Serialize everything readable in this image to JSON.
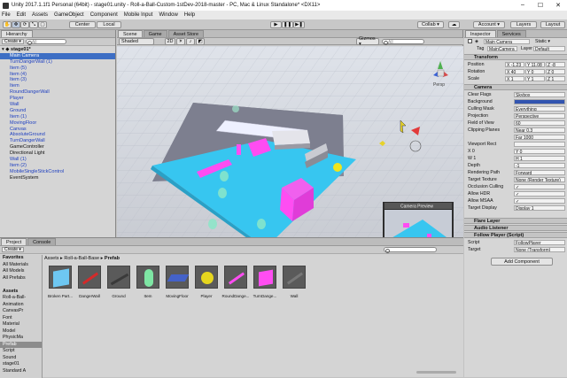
{
  "window": {
    "title": "Unity 2017.1.1f1 Personal (64bit) - stage01.unity - Roll-a-Ball-Custom-1stDev-2018-master - PC, Mac & Linux Standalone* <DX11>"
  },
  "menu": [
    "File",
    "Edit",
    "Assets",
    "GameObject",
    "Component",
    "Mobile Input",
    "Window",
    "Help"
  ],
  "toolbar": {
    "center": "Center",
    "local": "Local",
    "collab": "Collab ▾",
    "account": "Account ▾",
    "layers": "Layers",
    "layout": "Layout"
  },
  "hierarchy": {
    "tab": "Hierarchy",
    "create": "Create ▾",
    "search_placeholder": "All",
    "scene": "stage01*",
    "items": [
      {
        "label": "Main Camera",
        "sel": true
      },
      {
        "label": "TurnDangerWall (1)",
        "blue": true
      },
      {
        "label": "Item (5)",
        "blue": true
      },
      {
        "label": "Item (4)",
        "blue": true
      },
      {
        "label": "Item (3)",
        "blue": true
      },
      {
        "label": "Item",
        "blue": true
      },
      {
        "label": "RoundDangerWall",
        "blue": true
      },
      {
        "label": "Player",
        "blue": true
      },
      {
        "label": "Wall",
        "blue": true
      },
      {
        "label": "Ground",
        "blue": true
      },
      {
        "label": "Item (1)",
        "blue": true
      },
      {
        "label": "MovingFloor",
        "blue": true
      },
      {
        "label": "Canvas",
        "blue": true
      },
      {
        "label": "AbsoluteGround",
        "blue": true
      },
      {
        "label": "TurnDangerWall",
        "blue": true
      },
      {
        "label": "GameController"
      },
      {
        "label": "Directional Light"
      },
      {
        "label": "Wall (1)",
        "blue": true
      },
      {
        "label": "Item (2)",
        "blue": true
      },
      {
        "label": "MobileSingleStickControl",
        "blue": true
      },
      {
        "label": "EventSystem"
      }
    ]
  },
  "scene": {
    "tabs": [
      "Scene",
      "Game",
      "Asset Store"
    ],
    "shading": "Shaded",
    "mode2d": "2D",
    "gizmos": "Gizmos ▾",
    "search_placeholder": "All",
    "persp": "Persp",
    "camera_preview": "Camera Preview"
  },
  "inspector": {
    "tabs": [
      "Inspector",
      "Services"
    ],
    "object_name": "Main Camera",
    "static": "Static ▾",
    "tag_label": "Tag",
    "tag": "MainCamera",
    "layer_label": "Layer",
    "layer": "Default",
    "transform": {
      "title": "Transform",
      "position": {
        "label": "Position",
        "x": "X -1.23",
        "y": "Y 11.08",
        "z": "Z -8"
      },
      "rotation": {
        "label": "Rotation",
        "x": "X 40",
        "y": "Y 0",
        "z": "Z 0"
      },
      "scale": {
        "label": "Scale",
        "x": "X 1",
        "y": "Y 1",
        "z": "Z 1"
      }
    },
    "camera": {
      "title": "Camera",
      "rows": [
        {
          "label": "Clear Flags",
          "value": "Skybox"
        },
        {
          "label": "Background",
          "value": ""
        },
        {
          "label": "Culling Mask",
          "value": "Everything"
        },
        {
          "label": "Projection",
          "value": "Perspective"
        },
        {
          "label": "Field of View",
          "value": "60"
        },
        {
          "label": "Clipping Planes",
          "value": "Near 0.3"
        },
        {
          "label": "",
          "value": "Far 1000"
        },
        {
          "label": "Viewport Rect",
          "value": ""
        },
        {
          "label": "X 0",
          "value": "Y 0"
        },
        {
          "label": "W 1",
          "value": "H 1"
        },
        {
          "label": "Depth",
          "value": "-1"
        },
        {
          "label": "Rendering Path",
          "value": "Forward"
        },
        {
          "label": "Target Texture",
          "value": "None (Render Texture)"
        },
        {
          "label": "Occlusion Culling",
          "value": "✓"
        },
        {
          "label": "Allow HDR",
          "value": "✓"
        },
        {
          "label": "Allow MSAA",
          "value": "✓"
        },
        {
          "label": "Target Display",
          "value": "Display 1"
        }
      ]
    },
    "flare_layer": "Flare Layer",
    "audio_listener": "Audio Listener",
    "follow_player": {
      "title": "Follow Player (Script)",
      "script_label": "Script",
      "script": "FollowPlayer",
      "target_label": "Target",
      "target": "None (Transform)"
    },
    "add_component": "Add Component"
  },
  "project": {
    "tabs": [
      "Project",
      "Console"
    ],
    "create": "Create ▾",
    "breadcrumb": [
      "Assets",
      "Roll-a-Ball-Base",
      "Prefab"
    ],
    "tree": [
      {
        "label": "Favorites",
        "bold": true
      },
      {
        "label": "All Materials"
      },
      {
        "label": "All Models"
      },
      {
        "label": "All Prefabs"
      },
      {
        "label": ""
      },
      {
        "label": "Assets",
        "bold": true
      },
      {
        "label": "Roll-a-Ball-"
      },
      {
        "label": "Animation"
      },
      {
        "label": "CanvasPr"
      },
      {
        "label": "Font"
      },
      {
        "label": "Material"
      },
      {
        "label": "Model"
      },
      {
        "label": "PhysicMa"
      },
      {
        "label": "Prefab",
        "sel": true
      },
      {
        "label": "Script"
      },
      {
        "label": "Sound"
      },
      {
        "label": "stage01"
      },
      {
        "label": "Standard A"
      }
    ],
    "assets": [
      {
        "label": "Broken Part...",
        "icon": "cube-blue-icon"
      },
      {
        "label": "DangerWall",
        "icon": "red-bar-icon"
      },
      {
        "label": "Ground",
        "icon": "flat-plane-icon"
      },
      {
        "label": "Item",
        "icon": "green-capsule-icon"
      },
      {
        "label": "MovingFloor",
        "icon": "blue-tile-icon"
      },
      {
        "label": "Player",
        "icon": "yellow-ball-icon"
      },
      {
        "label": "RoundDange...",
        "icon": "pink-bar-icon"
      },
      {
        "label": "TurnDange...",
        "icon": "pink-cube-icon"
      },
      {
        "label": "Wall",
        "icon": "gray-bar-icon"
      }
    ]
  },
  "colors": {
    "selection": "#3d6ec4",
    "ground": "#37c6f0",
    "danger": "#ff4df2",
    "item": "#8be6c8",
    "player": "#f0e51c"
  }
}
